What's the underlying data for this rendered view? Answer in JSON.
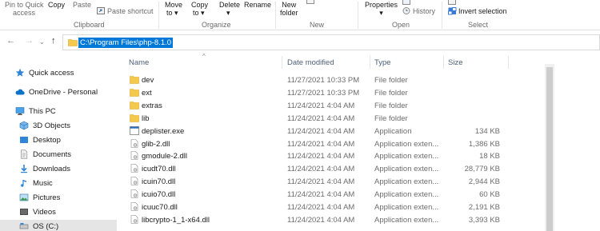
{
  "ribbon": {
    "clipboard": {
      "pin_line1": "Pin to Quick",
      "pin_line2": "access",
      "copy": "Copy",
      "paste": "Paste",
      "paste_shortcut": "Paste shortcut",
      "group": "Clipboard"
    },
    "organize": {
      "move_line1": "Move",
      "move_line2": "to",
      "copy_line1": "Copy",
      "copy_line2": "to",
      "delete": "Delete",
      "rename": "Rename",
      "group": "Organize"
    },
    "new": {
      "new_line1": "New",
      "new_line2": "folder",
      "group": "New"
    },
    "open": {
      "properties": "Properties",
      "history": "History",
      "group": "Open"
    },
    "select": {
      "invert": "Invert selection",
      "group": "Select"
    }
  },
  "address": {
    "path": "C:\\Program Files\\php-8.1.0"
  },
  "nav_pane": [
    {
      "label": "Quick access",
      "icon": "star-icon"
    },
    {
      "label": "OneDrive - Personal",
      "icon": "cloud-icon"
    },
    {
      "label": "This PC",
      "icon": "computer-icon"
    },
    {
      "label": "3D Objects",
      "icon": "cube-icon"
    },
    {
      "label": "Desktop",
      "icon": "desktop-icon"
    },
    {
      "label": "Documents",
      "icon": "document-icon"
    },
    {
      "label": "Downloads",
      "icon": "download-icon"
    },
    {
      "label": "Music",
      "icon": "music-icon"
    },
    {
      "label": "Pictures",
      "icon": "picture-icon"
    },
    {
      "label": "Videos",
      "icon": "video-icon"
    },
    {
      "label": "OS (C:)",
      "icon": "drive-icon"
    }
  ],
  "columns": {
    "name": "Name",
    "date": "Date modified",
    "type": "Type",
    "size": "Size"
  },
  "files": [
    {
      "name": "dev",
      "date": "11/27/2021 10:33 PM",
      "type": "File folder",
      "size": "",
      "kind": "folder"
    },
    {
      "name": "ext",
      "date": "11/27/2021 10:33 PM",
      "type": "File folder",
      "size": "",
      "kind": "folder"
    },
    {
      "name": "extras",
      "date": "11/24/2021 4:04 AM",
      "type": "File folder",
      "size": "",
      "kind": "folder"
    },
    {
      "name": "lib",
      "date": "11/24/2021 4:04 AM",
      "type": "File folder",
      "size": "",
      "kind": "folder"
    },
    {
      "name": "deplister.exe",
      "date": "11/24/2021 4:04 AM",
      "type": "Application",
      "size": "134 KB",
      "kind": "exe"
    },
    {
      "name": "glib-2.dll",
      "date": "11/24/2021 4:04 AM",
      "type": "Application exten...",
      "size": "1,386 KB",
      "kind": "dll"
    },
    {
      "name": "gmodule-2.dll",
      "date": "11/24/2021 4:04 AM",
      "type": "Application exten...",
      "size": "18 KB",
      "kind": "dll"
    },
    {
      "name": "icudt70.dll",
      "date": "11/24/2021 4:04 AM",
      "type": "Application exten...",
      "size": "28,779 KB",
      "kind": "dll"
    },
    {
      "name": "icuin70.dll",
      "date": "11/24/2021 4:04 AM",
      "type": "Application exten...",
      "size": "2,944 KB",
      "kind": "dll"
    },
    {
      "name": "icuio70.dll",
      "date": "11/24/2021 4:04 AM",
      "type": "Application exten...",
      "size": "60 KB",
      "kind": "dll"
    },
    {
      "name": "icuuc70.dll",
      "date": "11/24/2021 4:04 AM",
      "type": "Application exten...",
      "size": "2,191 KB",
      "kind": "dll"
    },
    {
      "name": "libcrypto-1_1-x64.dll",
      "date": "11/24/2021 4:04 AM",
      "type": "Application exten...",
      "size": "3,393 KB",
      "kind": "dll"
    }
  ],
  "colors": {
    "selection": "#0078d7",
    "folder": "#f5c94d",
    "header_text": "#4c607a"
  }
}
